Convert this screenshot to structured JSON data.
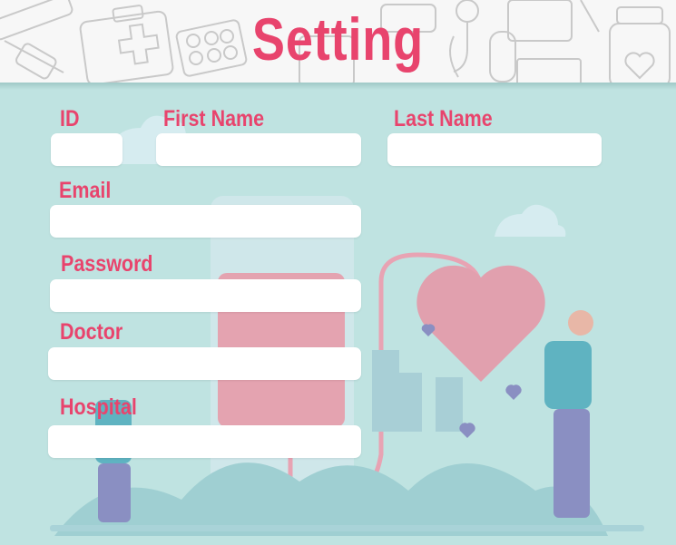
{
  "page": {
    "title": "Setting"
  },
  "form": {
    "id_label": "ID",
    "first_name_label": "First Name",
    "last_name_label": "Last Name",
    "email_label": "Email",
    "password_label": "Password",
    "doctor_label": "Doctor",
    "hospital_label": "Hospital",
    "id_value": "",
    "first_name_value": "",
    "last_name_value": "",
    "email_value": "",
    "password_value": "",
    "doctor_value": "",
    "hospital_value": ""
  },
  "colors": {
    "accent": "#e8446d",
    "background": "#bfe3e1",
    "header": "#f7f7f7"
  },
  "icons": [
    "medical-kit-icon",
    "pill-pack-icon",
    "stethoscope-icon",
    "medicine-bottle-icon",
    "heart-icon"
  ]
}
